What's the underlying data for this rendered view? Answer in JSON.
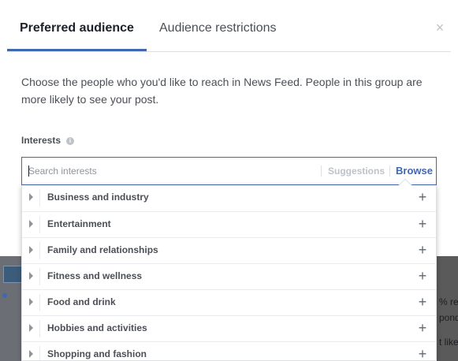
{
  "tabs": {
    "preferred_label": "Preferred audience",
    "restrictions_label": "Audience restrictions",
    "close_glyph": "×"
  },
  "description": "Choose the people who you'd like to reach in News Feed. People in this group are more likely to see your post.",
  "interests": {
    "label": "Interests",
    "info_glyph": "i",
    "search_placeholder": "Search interests",
    "search_value": "",
    "suggestions_label": "Suggestions",
    "browse_label": "Browse"
  },
  "categories": [
    {
      "label": "Business and industry",
      "add_glyph": "+"
    },
    {
      "label": "Entertainment",
      "add_glyph": "+"
    },
    {
      "label": "Family and relationships",
      "add_glyph": "+"
    },
    {
      "label": "Fitness and wellness",
      "add_glyph": "+"
    },
    {
      "label": "Food and drink",
      "add_glyph": "+"
    },
    {
      "label": "Hobbies and activities",
      "add_glyph": "+"
    },
    {
      "label": "Shopping and fashion",
      "add_glyph": "+"
    }
  ],
  "background": {
    "snippet_1": "% res",
    "snippet_2": "pond",
    "snippet_3": "t like"
  },
  "colors": {
    "accent": "#4267b2",
    "text_primary": "#1d2129",
    "text_secondary": "#4b4f56",
    "muted": "#bec2c9",
    "overlay": "#545454"
  },
  "icons": {
    "close": "close-icon",
    "info": "info-icon",
    "expand": "triangle-right-icon",
    "add": "plus-icon"
  }
}
